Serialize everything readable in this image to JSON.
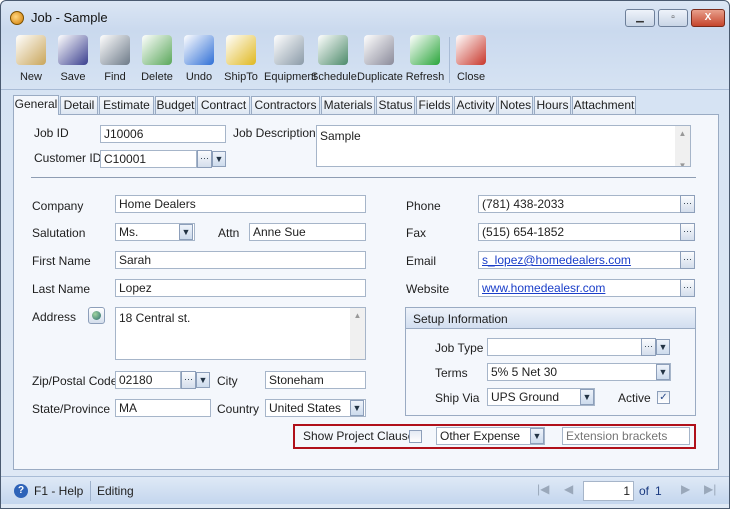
{
  "window": {
    "title": "Job - Sample"
  },
  "toolbar": [
    {
      "label": "New",
      "icon": "new-document-icon"
    },
    {
      "label": "Save",
      "icon": "floppy-disk-icon"
    },
    {
      "label": "Find",
      "icon": "binoculars-icon"
    },
    {
      "label": "Delete",
      "icon": "recycle-bin-icon"
    },
    {
      "label": "Undo",
      "icon": "undo-arrow-icon"
    },
    {
      "label": "ShipTo",
      "icon": "forklift-icon"
    },
    {
      "label": "Equipment",
      "icon": "wrench-icon"
    },
    {
      "label": "Schedule",
      "icon": "schedule-clock-icon"
    },
    {
      "label": "Duplicate",
      "icon": "duplicate-pages-icon"
    },
    {
      "label": "Refresh",
      "icon": "refresh-icon"
    },
    {
      "label": "Close",
      "icon": "close-window-icon"
    }
  ],
  "tabs": [
    "General",
    "Detail",
    "Estimate",
    "Budget",
    "Contract",
    "Contractors",
    "Materials",
    "Status",
    "Fields",
    "Activity",
    "Notes",
    "Hours",
    "Attachment"
  ],
  "active_tab": "General",
  "form": {
    "job_id_label": "Job ID",
    "job_id": "J10006",
    "customer_id_label": "Customer ID",
    "customer_id": "C10001",
    "job_description_label": "Job Description",
    "job_description": "Sample",
    "company_label": "Company",
    "company": "Home Dealers",
    "salutation_label": "Salutation",
    "salutation": "Ms.",
    "attn_label": "Attn",
    "attn": "Anne Sue",
    "first_name_label": "First Name",
    "first_name": "Sarah",
    "last_name_label": "Last Name",
    "last_name": "Lopez",
    "address_label": "Address",
    "address": "18 Central st.",
    "zip_label": "Zip/Postal Code",
    "zip": "02180",
    "city_label": "City",
    "city": "Stoneham",
    "state_label": "State/Province",
    "state": "MA",
    "country_label": "Country",
    "country": "United States",
    "phone_label": "Phone",
    "phone": "(781) 438-2033",
    "fax_label": "Fax",
    "fax": "(515) 654-1852",
    "email_label": "Email",
    "email": "s_lopez@homedealers.com",
    "website_label": "Website",
    "website": "www.homedealesr.com"
  },
  "setup": {
    "title": "Setup Information",
    "job_type_label": "Job Type",
    "job_type": "",
    "terms_label": "Terms",
    "terms": "5% 5 Net 30",
    "ship_via_label": "Ship Via",
    "ship_via": "UPS Ground",
    "active_label": "Active",
    "active": true
  },
  "highlight": {
    "show_project_clause_label": "Show Project Clause",
    "show_project_clause": false,
    "expense_type": "Other Expense",
    "extension_placeholder": "Extension brackets"
  },
  "status": {
    "help": "F1 - Help",
    "mode": "Editing",
    "page": "1",
    "of_label": "of",
    "total": "1"
  },
  "colors": {
    "highlight_border": "#b0101a",
    "link": "#1a3ec9"
  }
}
